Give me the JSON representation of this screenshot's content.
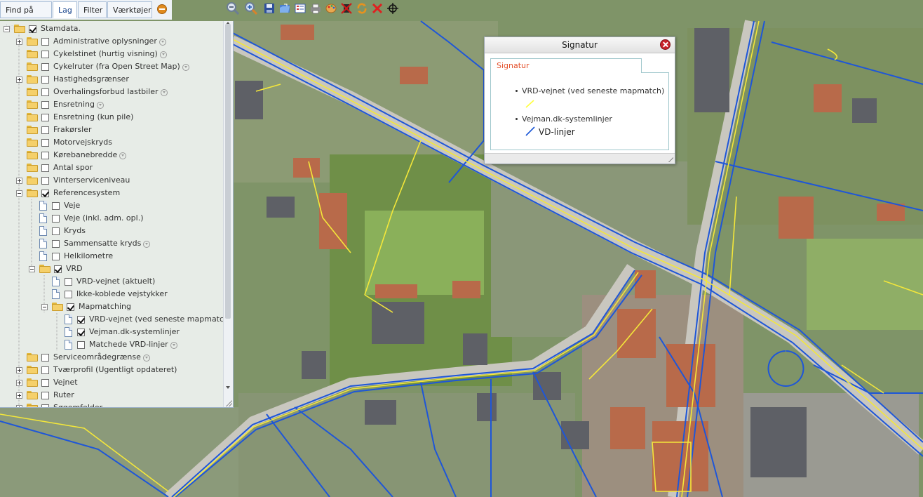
{
  "tabs": [
    {
      "label": "Find på kort"
    },
    {
      "label": "Lag"
    },
    {
      "label": "Filter"
    },
    {
      "label": "Værktøjer"
    }
  ],
  "active_tab": "Lag",
  "toolbar_icons": [
    "zoom-out-icon",
    "zoom-in-icon",
    "save-icon",
    "open-folder-icon",
    "legend-icon",
    "print-icon",
    "palette-icon",
    "delete-layer-icon",
    "refresh-icon",
    "close-icon",
    "crosshair-icon"
  ],
  "layers": [
    {
      "label": "Stamdata.",
      "checked": true,
      "info": false
    },
    {
      "label": "Administrative oplysninger",
      "checked": false,
      "info": true
    },
    {
      "label": "Cykelstinet (hurtig visning)",
      "checked": false,
      "info": true
    },
    {
      "label": "Cykelruter (fra Open Street Map)",
      "checked": false,
      "info": true
    },
    {
      "label": "Hastighedsgrænser",
      "checked": false,
      "info": false
    },
    {
      "label": "Overhalingsforbud lastbiler",
      "checked": false,
      "info": true
    },
    {
      "label": "Ensretning",
      "checked": false,
      "info": true
    },
    {
      "label": "Ensretning (kun pile)",
      "checked": false,
      "info": false
    },
    {
      "label": "Frakørsler",
      "checked": false,
      "info": false
    },
    {
      "label": "Motorvejskryds",
      "checked": false,
      "info": false
    },
    {
      "label": "Kørebanebredde",
      "checked": false,
      "info": true
    },
    {
      "label": "Antal spor",
      "checked": false,
      "info": false
    },
    {
      "label": "Vinterserviceniveau",
      "checked": false,
      "info": false
    },
    {
      "label": "Referencesystem",
      "checked": true,
      "info": false
    },
    {
      "label": "Veje",
      "checked": false,
      "info": false
    },
    {
      "label": "Veje (inkl. adm. opl.)",
      "checked": false,
      "info": false
    },
    {
      "label": "Kryds",
      "checked": false,
      "info": false
    },
    {
      "label": "Sammensatte kryds",
      "checked": false,
      "info": true
    },
    {
      "label": "Helkilometre",
      "checked": false,
      "info": false
    },
    {
      "label": "VRD",
      "checked": true,
      "info": false
    },
    {
      "label": "VRD-vejnet (aktuelt)",
      "checked": false,
      "info": false
    },
    {
      "label": "Ikke-koblede vejstykker",
      "checked": false,
      "info": false
    },
    {
      "label": "Mapmatching",
      "checked": true,
      "info": false
    },
    {
      "label": "VRD-vejnet (ved seneste mapmatch)",
      "checked": true,
      "info": true
    },
    {
      "label": "Vejman.dk-systemlinjer",
      "checked": true,
      "info": false
    },
    {
      "label": "Matchede VRD-linjer",
      "checked": false,
      "info": true
    },
    {
      "label": "Serviceområdegrænse",
      "checked": false,
      "info": true
    },
    {
      "label": "Tværprofil (Ugentligt opdateret)",
      "checked": false,
      "info": false
    },
    {
      "label": "Vejnet",
      "checked": false,
      "info": false
    },
    {
      "label": "Ruter",
      "checked": false,
      "info": false
    },
    {
      "label": "Søgemfelder",
      "checked": false,
      "info": false
    }
  ],
  "signatur": {
    "title": "Signatur",
    "tab_label": "Signatur",
    "items": [
      {
        "label": "VRD-vejnet (ved seneste mapmatch)",
        "symbol_color": "#ffff3b",
        "symbol_label": ""
      },
      {
        "label": "Vejman.dk-systemlinjer",
        "symbol_color": "#1a56d6",
        "symbol_label": "VD-linjer"
      }
    ]
  },
  "colors": {
    "vrd_line": "#f4e73a",
    "vejman_line": "#1e56d8",
    "tab_active_text": "#15428b",
    "signatur_tab_text": "#e4502a"
  }
}
